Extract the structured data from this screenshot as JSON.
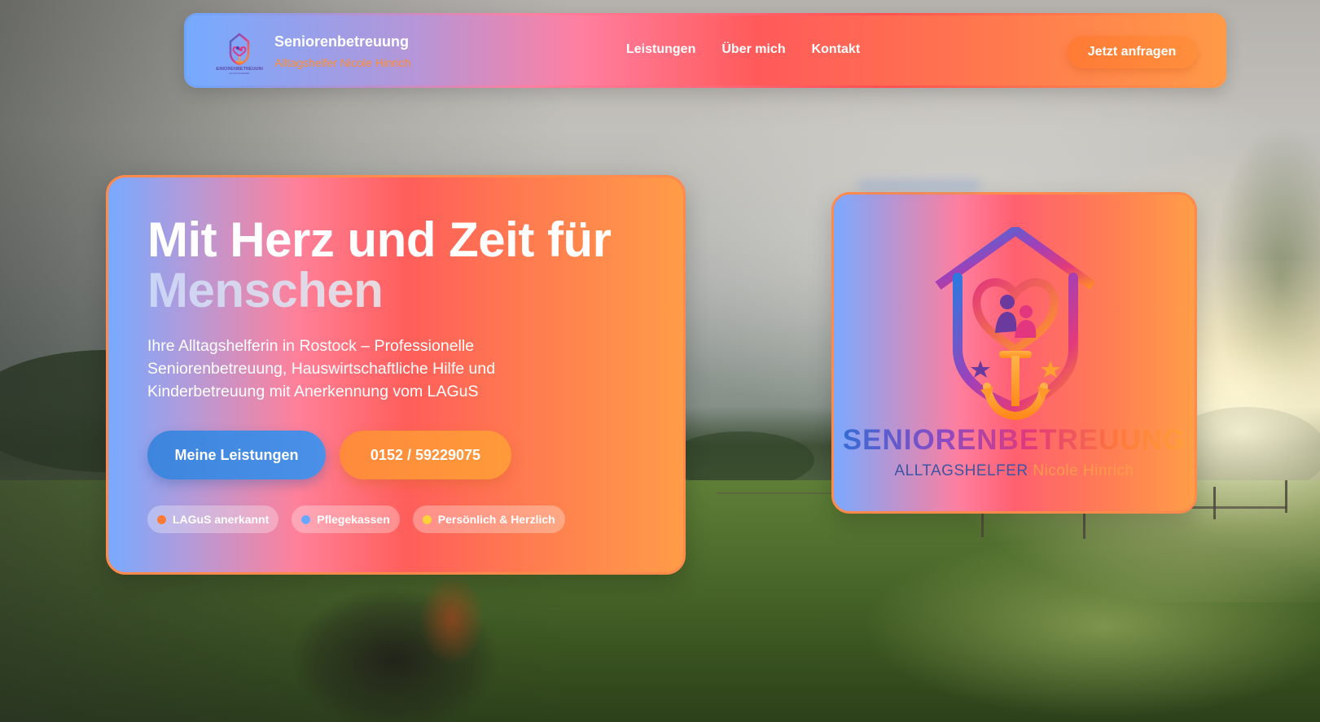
{
  "brand": {
    "title": "Seniorenbetreuung",
    "subtitle": "Alltagshelfer Nicole Hinrich"
  },
  "nav": {
    "links": [
      "Leistungen",
      "Über mich",
      "Kontakt"
    ],
    "cta": "Jetzt anfragen"
  },
  "hero": {
    "title_line1": "Mit Herz und Zeit für",
    "title_line2": "Menschen",
    "description": "Ihre Alltagshelferin in Rostock – Professionelle Seniorenbetreuung, Hauswirtschaftliche Hilfe und Kinderbetreuung mit Anerkennung vom LAGuS",
    "primary_button": "Meine Leistungen",
    "phone_button": "0152 / 59229075",
    "badges": [
      {
        "label": "LAGuS anerkannt",
        "color": "#ff7a36"
      },
      {
        "label": "Pflegekassen",
        "color": "#6aa8ff"
      },
      {
        "label": "Persönlich & Herzlich",
        "color": "#ffd23a"
      }
    ]
  },
  "logo_card": {
    "wordmark": "SENIORENBETREUUNG",
    "sub_part1": "ALLTAGSHELFER",
    "sub_part2": "Nicole Hinrich"
  },
  "colors": {
    "accent_orange": "#ff8a3c",
    "accent_blue": "#4a90e8",
    "gradient_start": "#76aaff",
    "gradient_mid": "#ff5a5a",
    "gradient_end": "#ff9a48"
  }
}
